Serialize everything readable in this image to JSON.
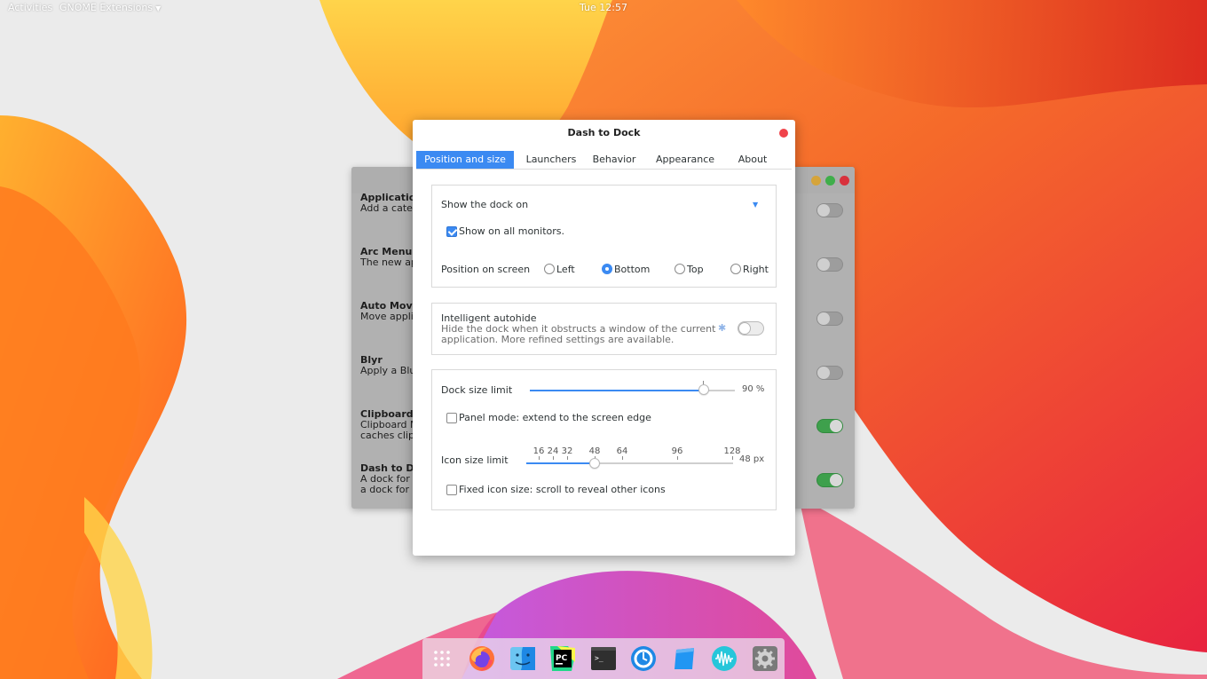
{
  "topbar": {
    "activities": "Activities",
    "app_menu": "GNOME Extensions",
    "clock": "Tue 12:57"
  },
  "extensions_window": {
    "items": [
      {
        "name": "Application",
        "desc": "Add a catego",
        "enabled": false
      },
      {
        "name": "Arc Menu",
        "desc": "The new app",
        "enabled": false
      },
      {
        "name": "Auto Move",
        "desc": "Move applic",
        "enabled": false
      },
      {
        "name": "Blyr",
        "desc": "Apply a Blur",
        "enabled": false
      },
      {
        "name": "Clipboard In",
        "desc": "Clipboard M",
        "desc2": "caches clipb",
        "enabled": true
      },
      {
        "name": "Dash to Doc",
        "desc": "A dock for th",
        "desc2": "a dock for ar",
        "enabled": true
      }
    ]
  },
  "dialog": {
    "title": "Dash to Dock",
    "tabs": [
      "Position and size",
      "Launchers",
      "Behavior",
      "Appearance",
      "About"
    ],
    "active_tab": "Position and size",
    "show_dock_on": {
      "label": "Show the dock on",
      "selected": ""
    },
    "show_all_monitors": {
      "label": "Show on all monitors.",
      "checked": true
    },
    "position": {
      "label": "Position on screen",
      "options": [
        "Left",
        "Bottom",
        "Top",
        "Right"
      ],
      "selected": "Bottom"
    },
    "autohide": {
      "title": "Intelligent autohide",
      "desc_line1": "Hide the dock when it obstructs a window of the current",
      "desc_line2": "application. More refined settings are available.",
      "enabled": false
    },
    "dock_size": {
      "label": "Dock size limit",
      "value_text": "90 %",
      "fraction": 0.9
    },
    "panel_mode": {
      "label": "Panel mode: extend to the screen edge",
      "checked": false
    },
    "icon_size": {
      "label": "Icon size limit",
      "ticks": [
        "16",
        "24",
        "32",
        "48",
        "64",
        "96",
        "128"
      ],
      "value_text": "48 px",
      "value": 48
    },
    "fixed_icon": {
      "label": "Fixed icon size: scroll to reveal other icons",
      "checked": false
    }
  },
  "dock": {
    "items": [
      "show-apps",
      "firefox",
      "finder",
      "pycharm",
      "terminal",
      "timeshift",
      "notes",
      "audio",
      "settings"
    ]
  },
  "colors": {
    "accent": "#3b8af2",
    "close": "#f0434b",
    "toggle_on": "#3ea04c"
  }
}
